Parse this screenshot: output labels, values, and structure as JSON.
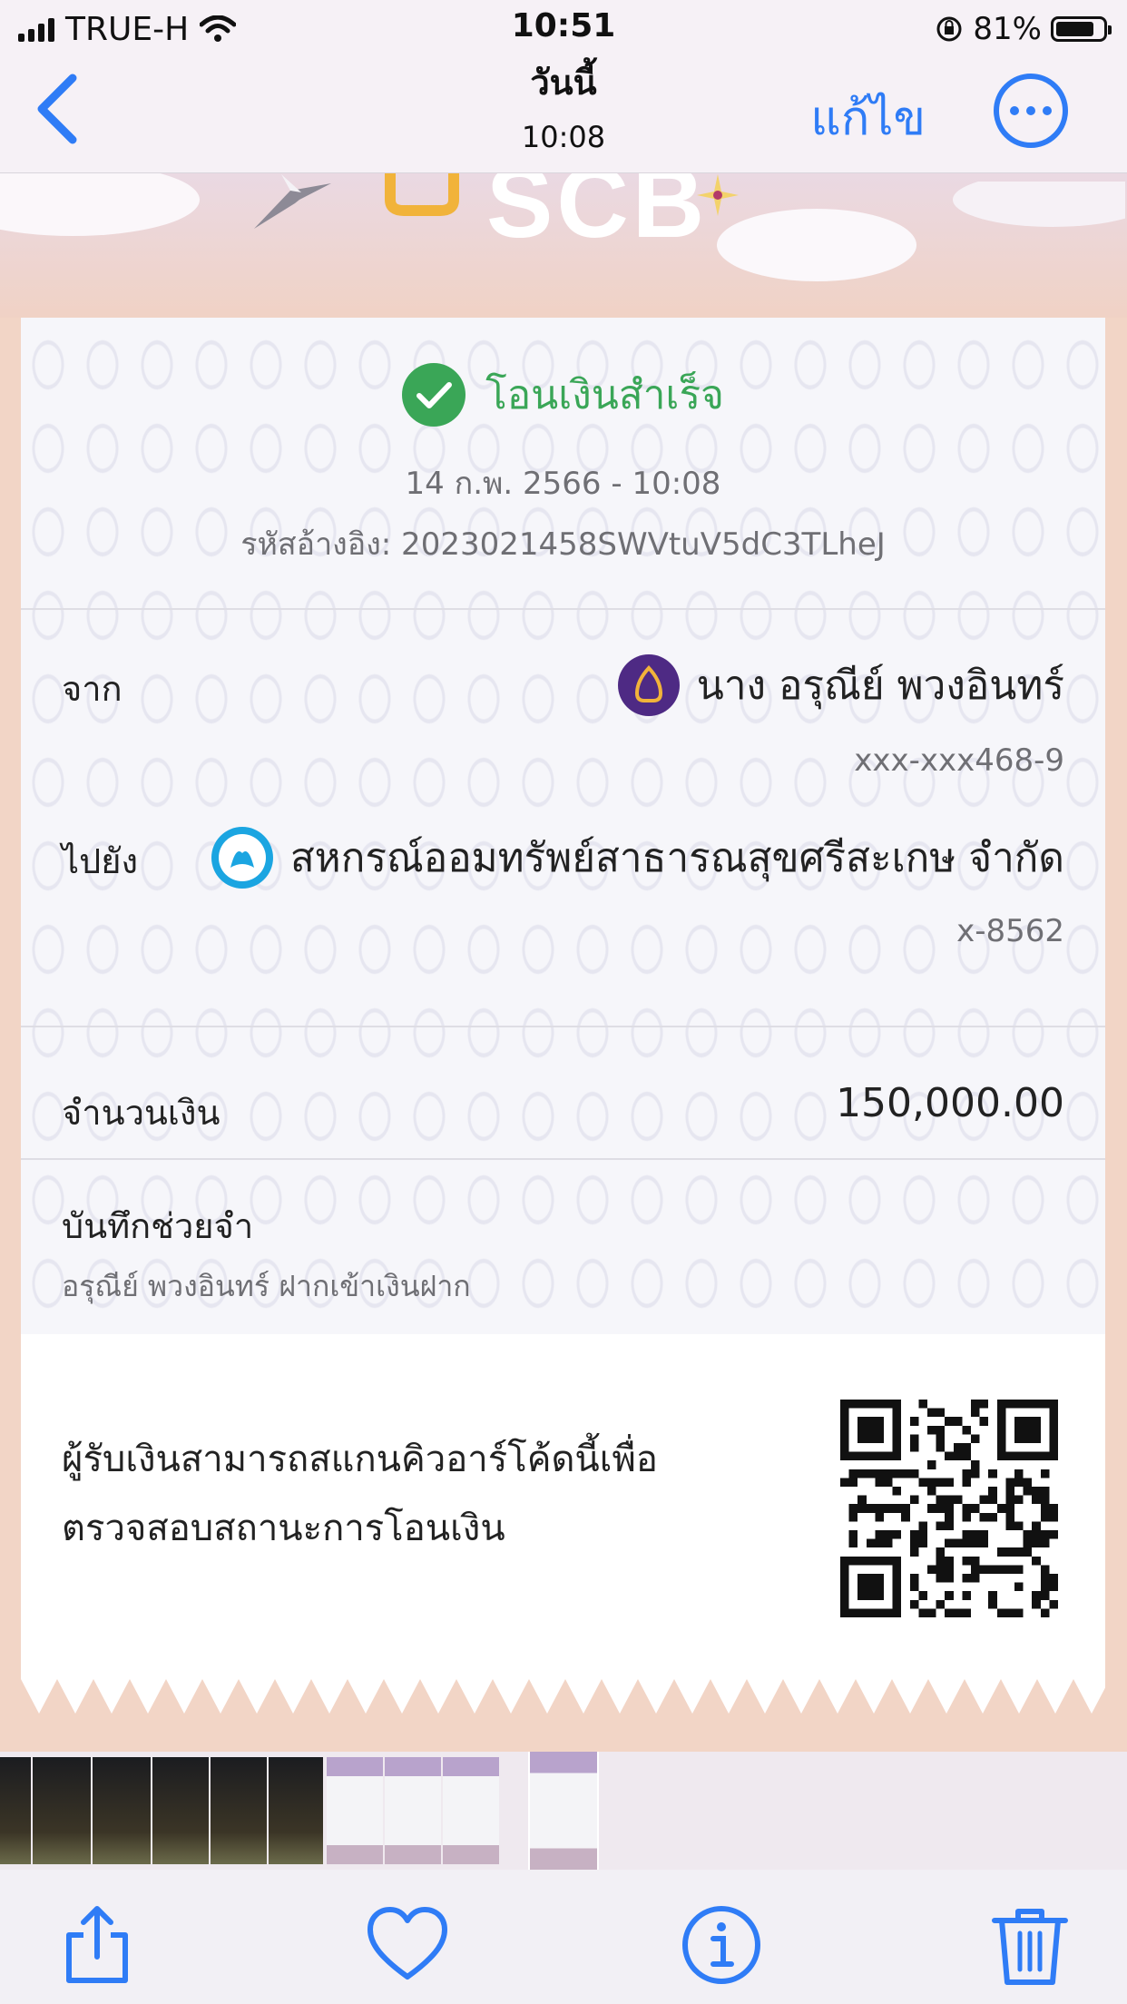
{
  "status": {
    "carrier": "TRUE-H",
    "time": "10:51",
    "battery": "81%",
    "battery_level": 0.81
  },
  "nav": {
    "title": "วันนี้",
    "subtitle": "10:08",
    "edit_label": "แก้ไข"
  },
  "header": {
    "logo_text": "SCB"
  },
  "receipt": {
    "status_text": "โอนเงินสำเร็จ",
    "datetime": "14 ก.พ. 2566 - 10:08",
    "reference": "รหัสอ้างอิง: 2023021458SWVtuV5dC3TLheJ",
    "from": {
      "label": "จาก",
      "name": "นาง อรุณีย์ พวงอินทร์",
      "account": "xxx-xxx468-9"
    },
    "to": {
      "label": "ไปยัง",
      "name": "สหกรณ์ออมทรัพย์สาธารณสุขศรีสะเกษ จำกัด",
      "account": "x-8562"
    },
    "amount": {
      "label": "จำนวนเงิน",
      "value": "150,000.00"
    },
    "memo": {
      "label": "บันทึกช่วยจำ",
      "text": "อรุณีย์ พวงอินทร์ ฝากเข้าเงินฝาก"
    },
    "qr": {
      "line1": "ผู้รับเงินสามารถสแกนคิวอาร์โค้ดนี้เพื่อ",
      "line2": "ตรวจสอบสถานะการโอนเงิน"
    }
  },
  "colors": {
    "accent_blue": "#2f7cf6",
    "success_green": "#3aa657",
    "scb_purple": "#4e2a84"
  },
  "toolbar": {
    "icons": [
      "share-icon",
      "heart-icon",
      "info-icon",
      "trash-icon"
    ]
  }
}
